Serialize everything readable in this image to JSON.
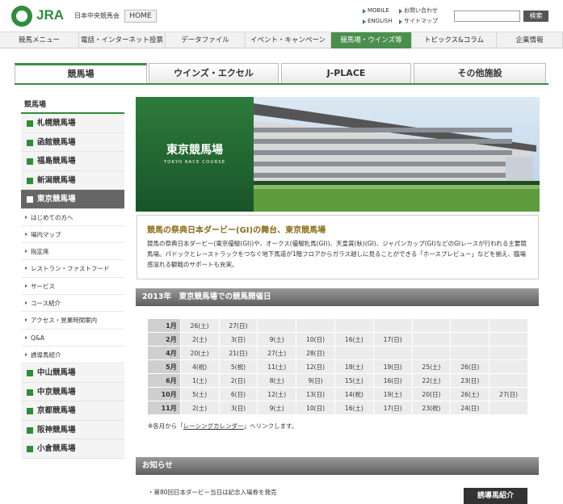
{
  "header": {
    "brand": "JRA",
    "org": "日本中央競馬会",
    "home": "HOME",
    "links": [
      "MOBILE",
      "お問い合わせ",
      "ENGLISH",
      "サイトマップ"
    ],
    "search_button": "検索",
    "search_icon": "search-icon"
  },
  "nav": [
    "競馬メニュー",
    "電話・インターネット投票",
    "データファイル",
    "イベント・キャンペーン",
    "競馬場・ウインズ等",
    "トピックス&コラム",
    "企業情報"
  ],
  "tabs": [
    "競馬場",
    "ウインズ・エクセル",
    "J-PLACE",
    "その他施設"
  ],
  "sidebar": {
    "heading": "競馬場",
    "tracks_top": [
      "札幌競馬場",
      "函館競馬場",
      "福島競馬場",
      "新潟競馬場",
      "東京競馬場"
    ],
    "sub": [
      "はじめての方へ",
      "場内マップ",
      "指定席",
      "レストラン・ファストフード",
      "サービス",
      "コース紹介",
      "アクセス・営業時間案内",
      "Q&A",
      "誘導馬紹介"
    ],
    "tracks_bottom": [
      "中山競馬場",
      "中京競馬場",
      "京都競馬場",
      "阪神競馬場",
      "小倉競馬場"
    ]
  },
  "hero": {
    "title": "東京競馬場",
    "subtitle": "TOKYO RACE COURSE"
  },
  "intro": {
    "title": "競馬の祭典日本ダービー(GI)の舞台、東京競馬場",
    "body": "競馬の祭典日本ダービー(東京優駿(GI))や、オークス(優駿牝馬(GI))、天皇賞(秋)(GI)、ジャパンカップ(GI)などのGIレースが行われる主要競馬場。パドックとレーストラックをつなぐ地下馬道が1階フロアからガラス越しに見ることができる「ホースプレビュー」などを揃え、臨場感溢れる観戦のサポートも充実。"
  },
  "schedule": {
    "heading": "2013年　東京競馬場での競馬開催日",
    "rows": [
      {
        "month": "1月",
        "days": [
          "26(土)",
          "27(日)",
          "",
          "",
          "",
          "",
          "",
          "",
          ""
        ]
      },
      {
        "month": "2月",
        "days": [
          "2(土)",
          "3(日)",
          "9(土)",
          "10(日)",
          "16(土)",
          "17(日)",
          "",
          "",
          ""
        ]
      },
      {
        "month": "4月",
        "days": [
          "20(土)",
          "21(日)",
          "27(土)",
          "28(日)",
          "",
          "",
          "",
          "",
          ""
        ]
      },
      {
        "month": "5月",
        "days": [
          "4(祝)",
          "5(祝)",
          "11(土)",
          "12(日)",
          "18(土)",
          "19(日)",
          "25(土)",
          "26(日)",
          ""
        ]
      },
      {
        "month": "6月",
        "days": [
          "1(土)",
          "2(日)",
          "8(土)",
          "9(日)",
          "15(土)",
          "16(日)",
          "22(土)",
          "23(日)",
          ""
        ]
      },
      {
        "month": "10月",
        "days": [
          "5(土)",
          "6(日)",
          "12(土)",
          "13(日)",
          "14(祝)",
          "19(土)",
          "20(日)",
          "26(土)",
          "27(日)"
        ]
      },
      {
        "month": "11月",
        "days": [
          "2(土)",
          "3(日)",
          "9(土)",
          "10(日)",
          "16(土)",
          "17(日)",
          "23(祝)",
          "24(日)",
          ""
        ]
      }
    ],
    "note_pre": "※各月から「",
    "note_link": "レーシングカレンダー",
    "note_post": "」へリンクします。"
  },
  "news": {
    "heading": "お知らせ",
    "item": "・第80回日本ダービー当日は記念入場券を発売",
    "badge": "誘導馬紹介"
  }
}
